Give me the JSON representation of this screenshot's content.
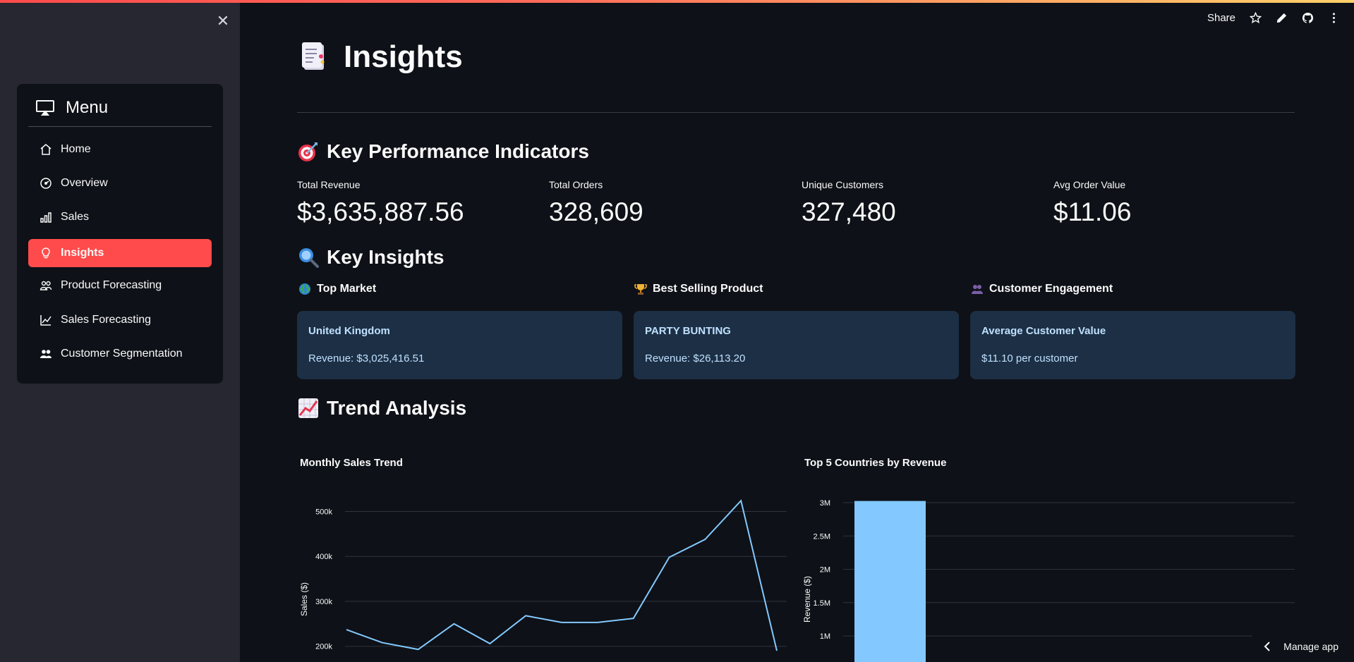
{
  "sidebar": {
    "menu_title": "Menu",
    "items": [
      {
        "label": "Home",
        "icon": "house-icon"
      },
      {
        "label": "Overview",
        "icon": "speedometer-icon"
      },
      {
        "label": "Sales",
        "icon": "bar-chart-icon"
      },
      {
        "label": "Insights",
        "icon": "lightbulb-icon"
      },
      {
        "label": "Product Forecasting",
        "icon": "people-icon"
      },
      {
        "label": "Sales Forecasting",
        "icon": "graph-up-icon"
      },
      {
        "label": "Customer Segmentation",
        "icon": "people-fill-icon"
      }
    ],
    "active_index": 3
  },
  "toolbar": {
    "share_label": "Share"
  },
  "page": {
    "title": "Insights"
  },
  "kpi": {
    "heading": "Key Performance Indicators",
    "metrics": [
      {
        "label": "Total Revenue",
        "value": "$3,635,887.56"
      },
      {
        "label": "Total Orders",
        "value": "328,609"
      },
      {
        "label": "Unique Customers",
        "value": "327,480"
      },
      {
        "label": "Avg Order Value",
        "value": "$11.06"
      }
    ]
  },
  "insights": {
    "heading": "Key Insights",
    "cards": [
      {
        "label": "Top Market",
        "title": "United Kingdom",
        "sub": "Revenue: $3,025,416.51"
      },
      {
        "label": "Best Selling Product",
        "title": "PARTY BUNTING",
        "sub": "Revenue: $26,113.20"
      },
      {
        "label": "Customer Engagement",
        "title": "Average Customer Value",
        "sub": "$11.10 per customer"
      }
    ]
  },
  "trend": {
    "heading": "Trend Analysis"
  },
  "chart_data": [
    {
      "type": "line",
      "title": "Monthly Sales Trend",
      "xlabel": "",
      "ylabel": "Sales ($)",
      "y_ticks": [
        "500k",
        "400k",
        "300k",
        "200k"
      ],
      "ylim": [
        165000,
        540000
      ],
      "series": [
        {
          "values": [
            237000,
            208000,
            193000,
            250000,
            206000,
            268000,
            253000,
            253000,
            262000,
            398000,
            438000,
            524000,
            190000
          ]
        }
      ],
      "color": "#83c9ff"
    },
    {
      "type": "bar",
      "title": "Top 5 Countries by Revenue",
      "xlabel": "",
      "ylabel": "Revenue ($)",
      "y_ticks": [
        "3M",
        "2.5M",
        "2M",
        "1.5M",
        "1M"
      ],
      "ylim": [
        500000,
        3100000
      ],
      "categories": [
        "",
        "",
        "",
        "",
        ""
      ],
      "values": [
        3025416.51
      ],
      "color": "#83c9ff"
    }
  ],
  "footer": {
    "manage_label": "Manage app"
  },
  "colors": {
    "accent": "#ff4b4b",
    "card_bg": "#1c2f44",
    "chart": "#83c9ff"
  }
}
